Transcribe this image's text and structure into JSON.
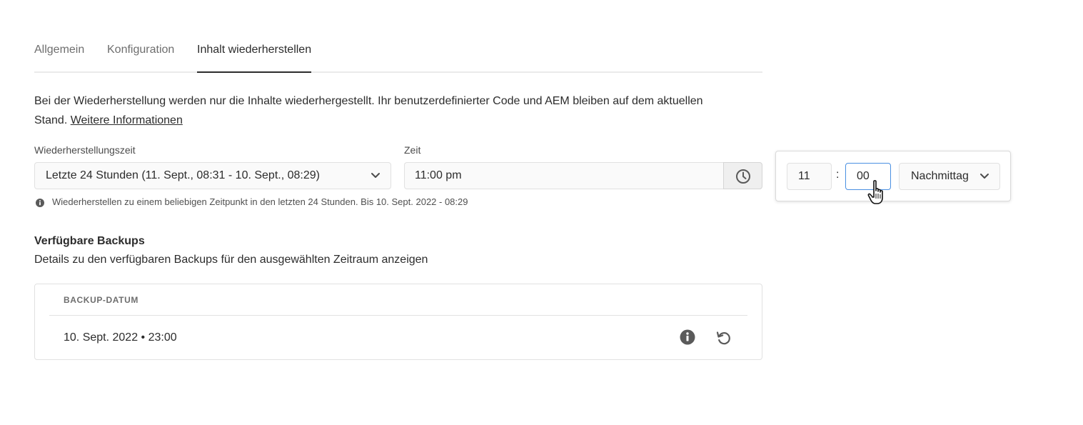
{
  "tabs": [
    {
      "label": "Allgemein",
      "active": false
    },
    {
      "label": "Konfiguration",
      "active": false
    },
    {
      "label": "Inhalt wiederherstellen",
      "active": true
    }
  ],
  "description": {
    "text": "Bei der Wiederherstellung werden nur die Inhalte wiederhergestellt. Ihr benutzerdefinierter Code und AEM bleiben auf dem aktuellen Stand.",
    "link": "Weitere Informationen"
  },
  "restore_time": {
    "label": "Wiederherstellungszeit",
    "value": "Letzte 24 Stunden (11. Sept., 08:31 - 10. Sept., 08:29)",
    "chevron_icon": "chevron-down-icon"
  },
  "time": {
    "label": "Zeit",
    "value": "11:00 pm",
    "button_icon": "clock-icon"
  },
  "hint": {
    "icon": "info-icon",
    "text": "Wiederherstellen zu einem beliebigen Zeitpunkt in den letzten 24 Stunden. Bis 10. Sept. 2022 - 08:29"
  },
  "time_popover": {
    "hour": "11",
    "separator": ":",
    "minute": "00",
    "period": "Nachmittag"
  },
  "backups": {
    "title": "Verfügbare Backups",
    "subtitle": "Details zu den verfügbaren Backups für den ausgewählten Zeitraum anzeigen",
    "column_header": "BACKUP-DATUM",
    "rows": [
      {
        "date": "10. Sept. 2022 • 23:00",
        "actions": [
          "info-icon",
          "restore-icon"
        ]
      }
    ]
  },
  "colors": {
    "text": "#2c2c2c",
    "muted": "#6e6e6e",
    "focus_border": "#4a90e2",
    "border": "#e1e1e1"
  }
}
